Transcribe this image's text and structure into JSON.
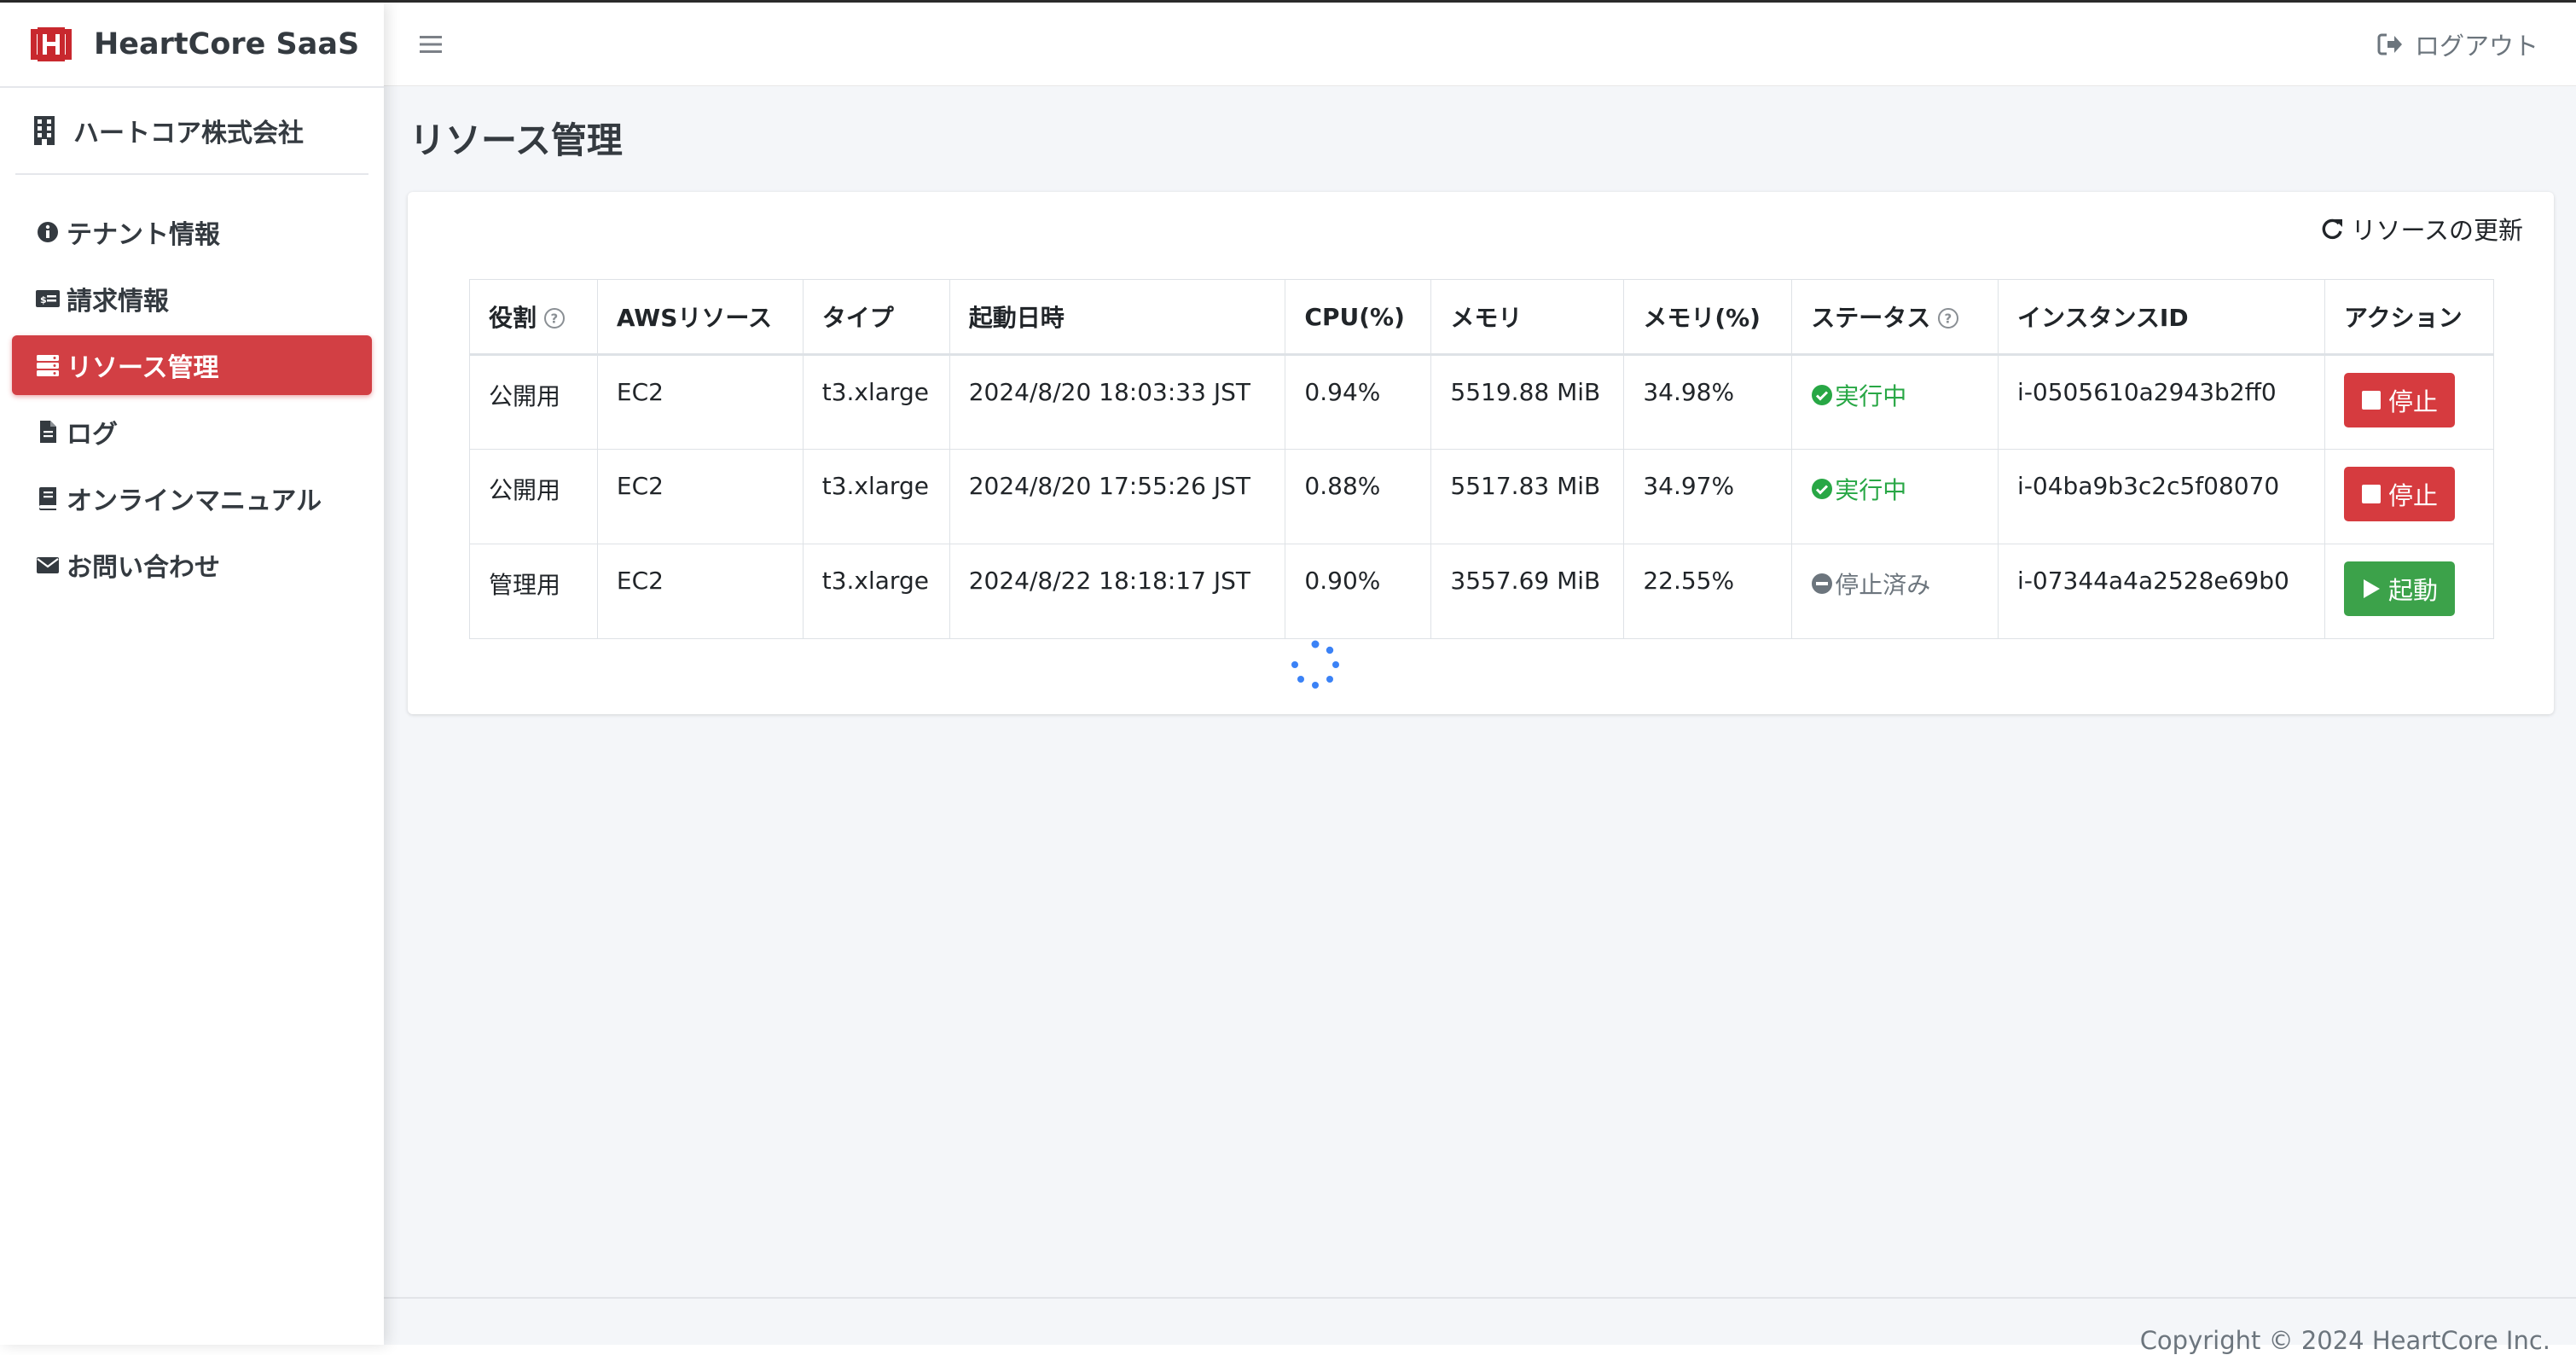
{
  "app": {
    "brand": "HeartCore SaaS"
  },
  "sidebar": {
    "company": "ハートコア株式会社",
    "items": [
      {
        "label": "テナント情報",
        "icon": "info-circle-icon",
        "active": false
      },
      {
        "label": "請求情報",
        "icon": "credit-card-icon",
        "active": false
      },
      {
        "label": "リソース管理",
        "icon": "server-icon",
        "active": true
      },
      {
        "label": "ログ",
        "icon": "file-icon",
        "active": false
      },
      {
        "label": "オンラインマニュアル",
        "icon": "book-icon",
        "active": false
      },
      {
        "label": "お問い合わせ",
        "icon": "envelope-icon",
        "active": false
      }
    ]
  },
  "header": {
    "logout_label": "ログアウト"
  },
  "page": {
    "title": "リソース管理"
  },
  "card": {
    "refresh_label": "リソースの更新"
  },
  "table": {
    "headers": [
      "役割",
      "AWSリソース",
      "タイプ",
      "起動日時",
      "CPU(%)",
      "メモリ",
      "メモリ(%)",
      "ステータス",
      "インスタンスID",
      "アクション"
    ],
    "rows": [
      {
        "role": "公開用",
        "resource": "EC2",
        "type": "t3.xlarge",
        "started": "2024/8/20 18:03:33 JST",
        "cpu": "0.94%",
        "memory": "5519.88 MiB",
        "memory_pct": "34.98%",
        "status": "実行中",
        "instance_id": "i-0505610a2943b2ff0",
        "action": "停止"
      },
      {
        "role": "公開用",
        "resource": "EC2",
        "type": "t3.xlarge",
        "started": "2024/8/20 17:55:26 JST",
        "cpu": "0.88%",
        "memory": "5517.83 MiB",
        "memory_pct": "34.97%",
        "status": "実行中",
        "instance_id": "i-04ba9b3c2c5f08070",
        "action": "停止"
      },
      {
        "role": "管理用",
        "resource": "EC2",
        "type": "t3.xlarge",
        "started": "2024/8/22 18:18:17 JST",
        "cpu": "0.90%",
        "memory": "3557.69 MiB",
        "memory_pct": "22.55%",
        "status": "停止済み",
        "instance_id": "i-07344a4a2528e69b0",
        "action": "起動"
      }
    ]
  },
  "footer": {
    "copyright": "Copyright © 2024 HeartCore Inc."
  },
  "colors": {
    "accent": "#d23f44",
    "success": "#28a745",
    "start_button": "#3ca24a",
    "background": "#f4f6f9",
    "spinner": "#3b82f6"
  }
}
